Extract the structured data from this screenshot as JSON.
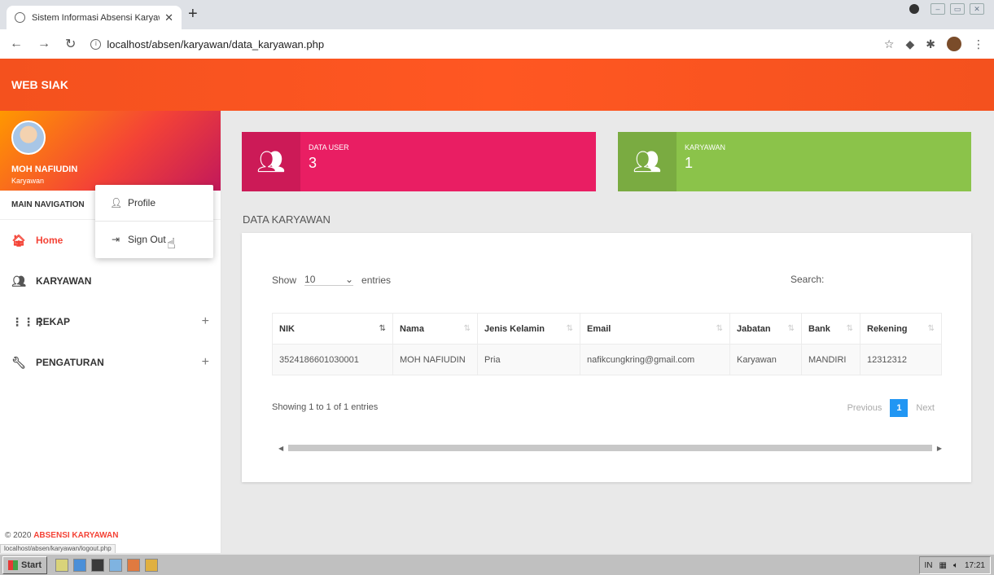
{
  "browser": {
    "tab_title": "Sistem Informasi Absensi Karyawa",
    "url": "localhost/absen/karyawan/data_karyawan.php"
  },
  "app": {
    "brand": "WEB SIAK"
  },
  "user": {
    "name": "MOH NAFIUDIN",
    "role": "Karyawan"
  },
  "sidebar": {
    "main_nav_label": "MAIN NAVIGATION",
    "items": [
      {
        "label": "Home",
        "icon": "home-icon"
      },
      {
        "label": "KARYAWAN",
        "icon": "people-icon"
      },
      {
        "label": "REKAP",
        "icon": "grid-icon"
      },
      {
        "label": "PENGATURAN",
        "icon": "wrench-icon"
      }
    ],
    "footer_prefix": "© 2020",
    "footer_brand": "ABSENSI KARYAWAN"
  },
  "dropdown": {
    "profile": "Profile",
    "signout": "Sign Out"
  },
  "status_url": "localhost/absen/karyawan/logout.php",
  "info_boxes": [
    {
      "label": "DATA USER",
      "value": "3",
      "color": "#e91e63"
    },
    {
      "label": "KARYAWAN",
      "value": "1",
      "color": "#8bc34a"
    }
  ],
  "section_title": "DATA KARYAWAN",
  "table_controls": {
    "show": "Show",
    "entries_value": "10",
    "entries": "entries",
    "search": "Search:"
  },
  "table": {
    "headers": [
      "NIK",
      "Nama",
      "Jenis Kelamin",
      "Email",
      "Jabatan",
      "Bank",
      "Rekening"
    ],
    "rows": [
      [
        "3524186601030001",
        "MOH NAFIUDIN",
        "Pria",
        "nafikcungkring@gmail.com",
        "Karyawan",
        "MANDIRI",
        "12312312"
      ]
    ]
  },
  "pagination": {
    "info": "Showing 1 to 1 of 1 entries",
    "previous": "Previous",
    "current": "1",
    "next": "Next"
  },
  "taskbar": {
    "start": "Start",
    "lang": "IN",
    "clock": "17:21"
  },
  "colors": {
    "header": "#ff5722",
    "accent": "#f44336",
    "pager": "#2196f3"
  }
}
